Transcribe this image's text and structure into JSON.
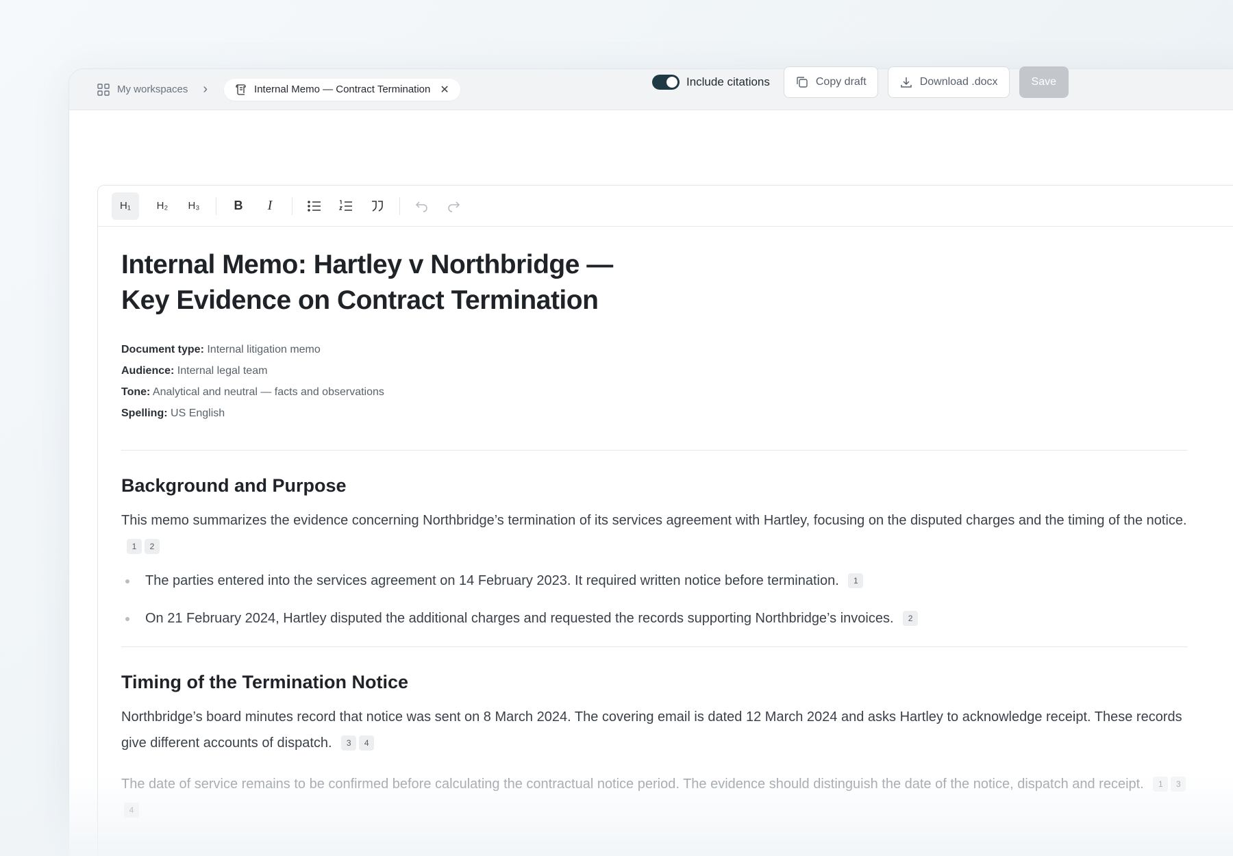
{
  "breadcrumb": {
    "workspaces_label": "My workspaces",
    "doc_tab_label": "Internal Memo — Contract Termination"
  },
  "actions": {
    "citations_label": "Include citations",
    "citations_on": true,
    "copy_label": "Copy draft",
    "download_label": "Download .docx",
    "save_label": "Save"
  },
  "toolbar": {
    "h1": "H₁",
    "h2": "H₂",
    "h3": "H₃",
    "bold": "B",
    "italic": "I"
  },
  "document": {
    "title_line1": "Internal Memo: Hartley v Northbridge —",
    "title_line2": "Key Evidence on Contract Termination",
    "meta": [
      {
        "key": "Document type:",
        "value": "Internal litigation memo"
      },
      {
        "key": "Audience:",
        "value": "Internal legal team"
      },
      {
        "key": "Tone:",
        "value": "Analytical and neutral — facts and observations"
      },
      {
        "key": "Spelling:",
        "value": "US English"
      }
    ],
    "section1": {
      "heading": "Background and Purpose",
      "paragraph": "This memo summarizes the evidence concerning Northbridge’s termination of its services agreement with Hartley, focusing on the disputed charges and the timing of the notice.",
      "paragraph_cites": [
        "1",
        "2"
      ],
      "bullets": [
        {
          "text": "The parties entered into the services agreement on 14 February 2023. It required written notice before termination.",
          "cites": [
            "1"
          ]
        },
        {
          "text": "On 21 February 2024, Hartley disputed the additional charges and requested the records supporting Northbridge’s invoices.",
          "cites": [
            "2"
          ]
        }
      ]
    },
    "section2": {
      "heading": "Timing of the Termination Notice",
      "paragraph": "Northbridge’s board minutes record that notice was sent on 8 March 2024. The covering email is dated 12 March 2024 and asks Hartley to acknowledge receipt. These records give different accounts of dispatch.",
      "paragraph_cites": [
        "3",
        "4"
      ],
      "faded_paragraph": "The date of service remains to be confirmed before calculating the contractual notice period. The evidence should distinguish the date of the notice, dispatch and receipt.",
      "faded_cites": [
        "1",
        "3",
        "4"
      ]
    }
  },
  "colors": {
    "toggle_on": "#1f3a44",
    "save_disabled": "#c3c7cb"
  }
}
